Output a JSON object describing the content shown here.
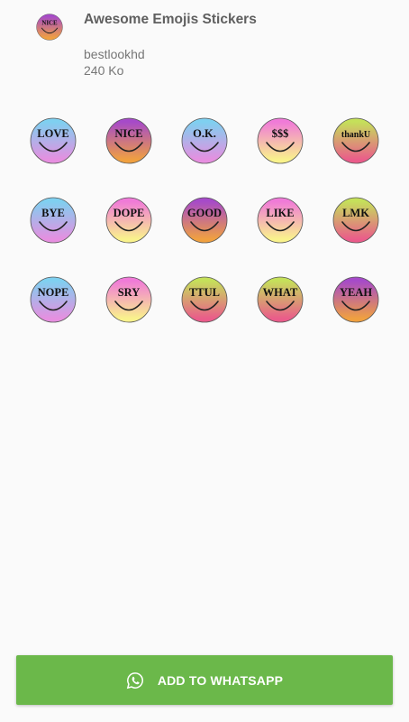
{
  "pack": {
    "title": "Awesome Emojis Stickers",
    "author": "bestlookhd",
    "size": "240 Ko",
    "icon": {
      "label": "NICE",
      "gradient": [
        "#a64ac9",
        "#f0a040"
      ]
    }
  },
  "stickers": [
    {
      "label": "LOVE",
      "gradient": [
        "#7fd0f0",
        "#e68fe0"
      ]
    },
    {
      "label": "NICE",
      "gradient": [
        "#a64ac9",
        "#f0a040"
      ]
    },
    {
      "label": "O.K.",
      "gradient": [
        "#7fd0f0",
        "#e68fe0"
      ]
    },
    {
      "label": "$$$",
      "gradient": [
        "#f07ad8",
        "#f9f28c"
      ]
    },
    {
      "label": "thankU",
      "gradient": [
        "#c5e05a",
        "#ea5c8a"
      ]
    },
    {
      "label": "BYE",
      "gradient": [
        "#7fd0f0",
        "#e68fe0"
      ]
    },
    {
      "label": "DOPE",
      "gradient": [
        "#f07ad8",
        "#f9f28c"
      ]
    },
    {
      "label": "GOOD",
      "gradient": [
        "#a64ac9",
        "#f0a040"
      ]
    },
    {
      "label": "LIKE",
      "gradient": [
        "#f07ad8",
        "#f9f28c"
      ]
    },
    {
      "label": "LMK",
      "gradient": [
        "#c5e05a",
        "#ea5c8a"
      ]
    },
    {
      "label": "NOPE",
      "gradient": [
        "#7fd0f0",
        "#e68fe0"
      ]
    },
    {
      "label": "SRY",
      "gradient": [
        "#f07ad8",
        "#f9f28c"
      ]
    },
    {
      "label": "TTUL",
      "gradient": [
        "#c5e05a",
        "#ea5c8a"
      ]
    },
    {
      "label": "WHAT",
      "gradient": [
        "#c5e05a",
        "#ea5c8a"
      ]
    },
    {
      "label": "YEAH",
      "gradient": [
        "#a64ac9",
        "#f0a040"
      ]
    }
  ],
  "add_button": {
    "label": "ADD TO WHATSAPP",
    "icon": "whatsapp-icon",
    "color": "#6bb84a"
  }
}
